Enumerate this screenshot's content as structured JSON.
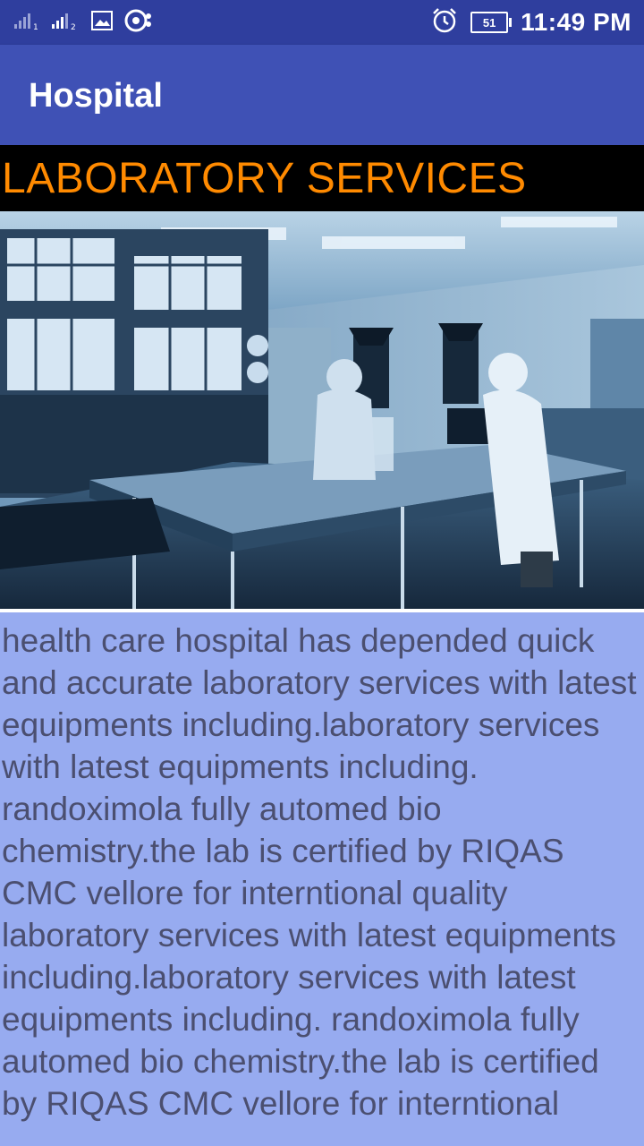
{
  "status_bar": {
    "time": "11:49 PM",
    "battery_level": "51",
    "icons": [
      "signal-sim1-icon",
      "signal-sim2-icon",
      "image-notification-icon",
      "app-notification-icon",
      "alarm-icon",
      "battery-icon"
    ]
  },
  "app_bar": {
    "title": "Hospital"
  },
  "section": {
    "title": "LABORATORY SERVICES",
    "title_color": "#ff8a00",
    "header_background": "#000000"
  },
  "content": {
    "body_text": "health care hospital has depended quick and accurate laboratory services with latest equipments including.laboratory services with latest equipments including. randoximola fully automed bio chemistry.the lab is certified by RIQAS CMC vellore for interntional quality laboratory services with latest equipments including.laboratory services with latest equipments including. randoximola fully automed bio chemistry.the lab is certified by RIQAS CMC vellore for interntional",
    "panel_background": "#97abf0"
  },
  "colors": {
    "status_bar": "#2f3e9e",
    "app_bar": "#3f51b5"
  }
}
